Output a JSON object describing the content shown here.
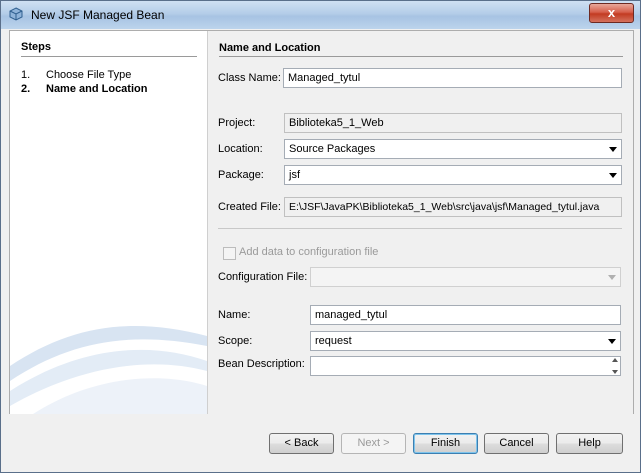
{
  "window": {
    "title": "New JSF Managed Bean",
    "close_glyph": "x"
  },
  "steps": {
    "heading": "Steps",
    "items": [
      {
        "num": "1.",
        "label": "Choose File Type"
      },
      {
        "num": "2.",
        "label": "Name and Location"
      }
    ]
  },
  "panel": {
    "heading": "Name and Location",
    "class_name_label": "Class Name:",
    "class_name_value": "Managed_tytul",
    "project_label": "Project:",
    "project_value": "Biblioteka5_1_Web",
    "location_label": "Location:",
    "location_value": "Source Packages",
    "package_label": "Package:",
    "package_value": "jsf",
    "created_file_label": "Created File:",
    "created_file_value": "E:\\JSF\\JavaPK\\Biblioteka5_1_Web\\src\\java\\jsf\\Managed_tytul.java",
    "add_config_label": "Add data to configuration file",
    "config_file_label": "Configuration File:",
    "config_file_value": "",
    "name_label": "Name:",
    "name_value": "managed_tytul",
    "scope_label": "Scope:",
    "scope_value": "request",
    "bean_desc_label": "Bean Description:",
    "bean_desc_value": ""
  },
  "buttons": {
    "back": "< Back",
    "next": "Next >",
    "finish": "Finish",
    "cancel": "Cancel",
    "help": "Help"
  },
  "colors": {
    "title_gradient": "#b4cde8",
    "close": "#c23b22",
    "dialog_bg": "#f0f0f0"
  }
}
